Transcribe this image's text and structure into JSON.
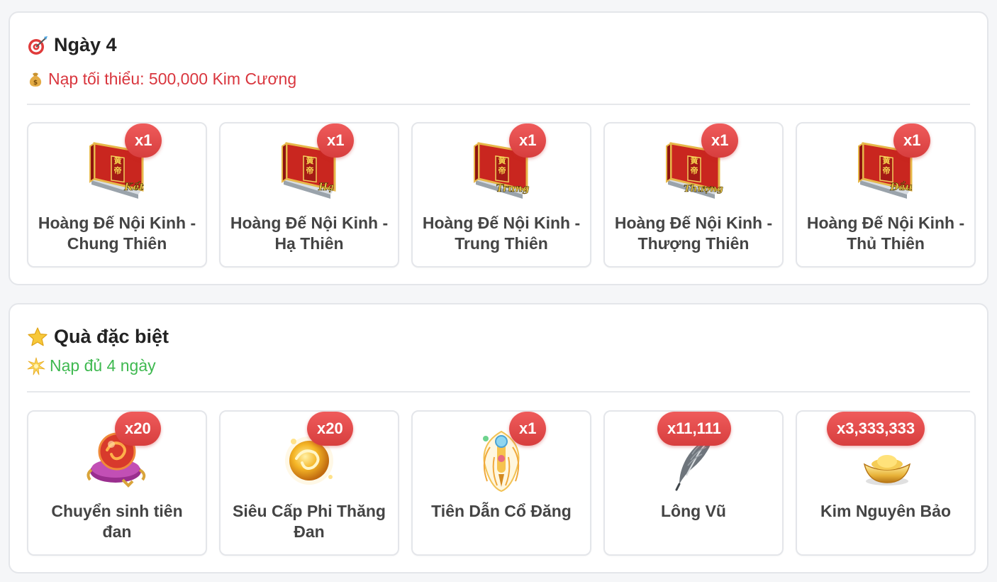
{
  "day_section": {
    "title": "Ngày 4",
    "title_icon": "target-icon",
    "subtitle": "Nạp tối thiểu: 500,000 Kim Cương",
    "subtitle_icon": "money-bag-icon",
    "subtitle_color": "#d9363e",
    "items": [
      {
        "name": "Hoàng Đế Nội Kinh - Chung Thiên",
        "qty": "x1",
        "book_label": "Kết",
        "icon": "red-book-icon"
      },
      {
        "name": "Hoàng Đế Nội Kinh - Hạ Thiên",
        "qty": "x1",
        "book_label": "Hạ",
        "icon": "red-book-icon"
      },
      {
        "name": "Hoàng Đế Nội Kinh - Trung Thiên",
        "qty": "x1",
        "book_label": "Trung",
        "icon": "red-book-icon"
      },
      {
        "name": "Hoàng Đế Nội Kinh - Thượng Thiên",
        "qty": "x1",
        "book_label": "Thượng",
        "icon": "red-book-icon"
      },
      {
        "name": "Hoàng Đế Nội Kinh - Thủ Thiên",
        "qty": "x1",
        "book_label": "Đầu",
        "icon": "red-book-icon"
      }
    ]
  },
  "special_section": {
    "title": "Quà đặc biệt",
    "title_icon": "star-icon",
    "subtitle": "Nạp đủ 4 ngày",
    "subtitle_icon": "glowing-star-icon",
    "subtitle_color": "#3fb950",
    "items": [
      {
        "name": "Chuyển sinh tiên đan",
        "qty": "x20",
        "icon": "pill-cushion-icon"
      },
      {
        "name": "Siêu Cấp Phi Thăng Đan",
        "qty": "x20",
        "icon": "golden-orb-icon"
      },
      {
        "name": "Tiên Dẫn Cổ Đăng",
        "qty": "x1",
        "icon": "lantern-icon"
      },
      {
        "name": "Lông Vũ",
        "qty": "x11,111",
        "icon": "feather-icon"
      },
      {
        "name": "Kim Nguyên Bảo",
        "qty": "x3,333,333",
        "icon": "gold-ingot-icon"
      }
    ]
  }
}
